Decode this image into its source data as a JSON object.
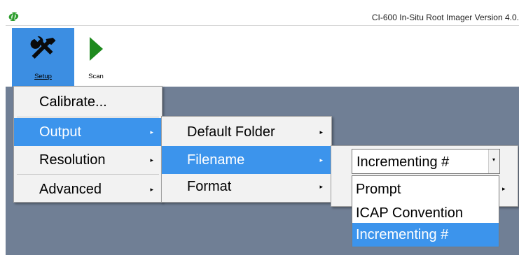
{
  "window": {
    "title": "CI-600 In-Situ Root Imager Version 4.0.",
    "logo_glyph": "Φ",
    "logo_color": "#2e9e2e"
  },
  "toolbar": {
    "setup": {
      "label": "Setup",
      "icon": "tools-icon",
      "active": true
    },
    "scan": {
      "label": "Scan",
      "icon": "play-icon"
    }
  },
  "setup_menu": {
    "items": [
      {
        "label": "Calibrate...",
        "submenu": false
      },
      {
        "label": "Output",
        "submenu": true,
        "selected": true
      },
      {
        "label": "Resolution",
        "submenu": true
      },
      {
        "label": "Advanced",
        "submenu": true
      }
    ]
  },
  "output_menu": {
    "items": [
      {
        "label": "Default Folder",
        "submenu": true
      },
      {
        "label": "Filename",
        "submenu": true,
        "selected": true
      },
      {
        "label": "Format",
        "submenu": true
      }
    ]
  },
  "filename_options": {
    "current_value": "Incrementing #",
    "options": [
      "Prompt",
      "ICAP Convention",
      "Incrementing #"
    ],
    "selected_index": 2
  },
  "colors": {
    "accent": "#3c94ec",
    "workspace": "#707f95",
    "menu_bg": "#f2f2f2",
    "scan_icon": "#1e8a1e"
  },
  "glyphs": {
    "submenu_arrow": "▸",
    "combo_arrow": "▾"
  }
}
